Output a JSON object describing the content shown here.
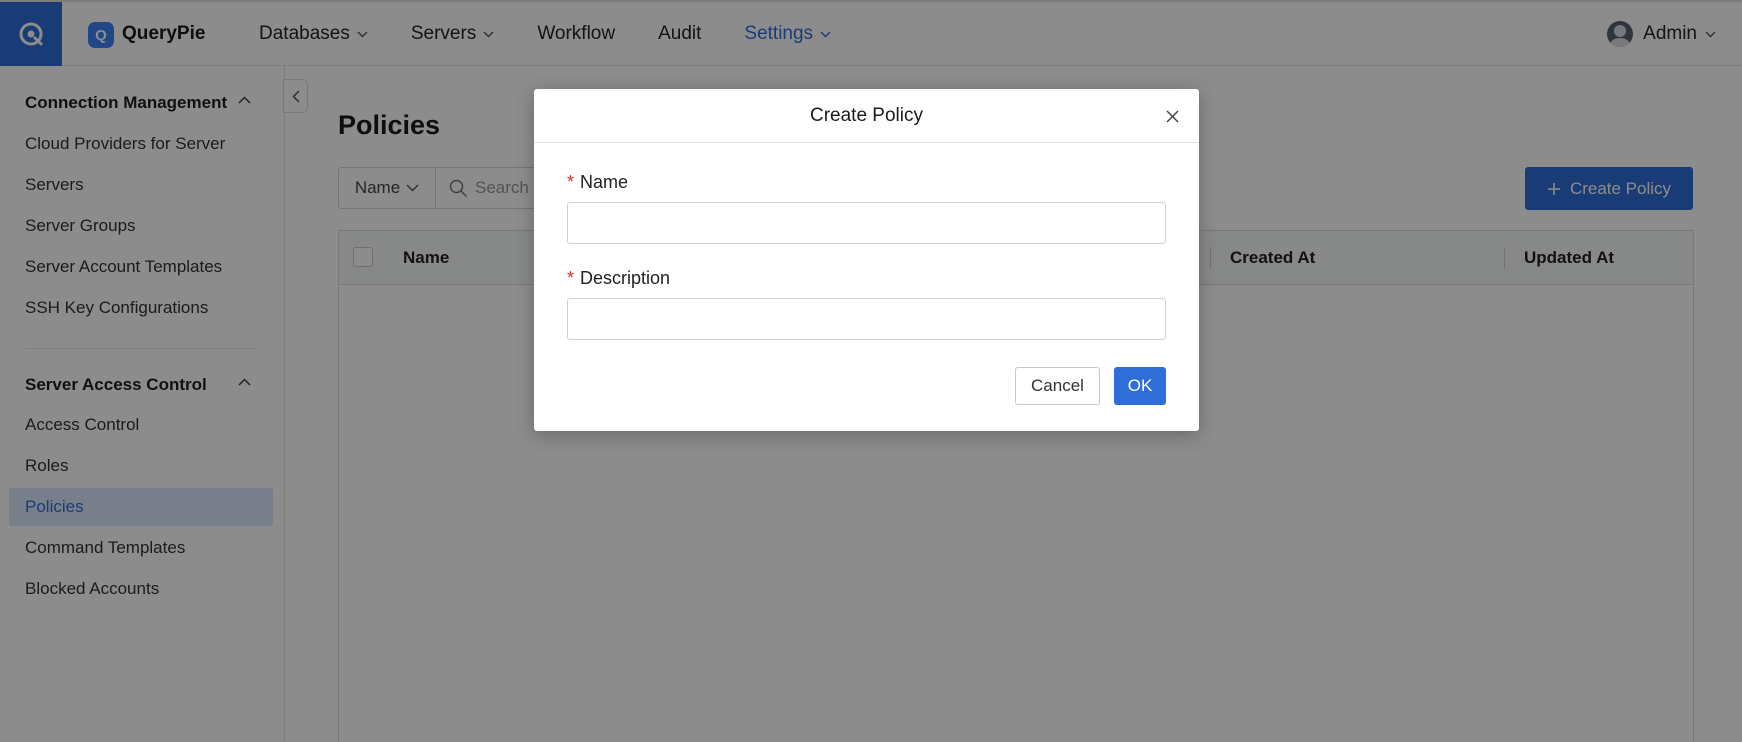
{
  "app": {
    "name": "QueryPie",
    "logo_letter": "Q"
  },
  "nav": {
    "items": [
      {
        "label": "Databases",
        "has_dropdown": true,
        "active": false
      },
      {
        "label": "Servers",
        "has_dropdown": true,
        "active": false
      },
      {
        "label": "Workflow",
        "has_dropdown": false,
        "active": false
      },
      {
        "label": "Audit",
        "has_dropdown": false,
        "active": false
      },
      {
        "label": "Settings",
        "has_dropdown": true,
        "active": true
      }
    ],
    "user": "Admin"
  },
  "sidebar": {
    "sections": [
      {
        "title": "Connection Management",
        "items": [
          "Cloud Providers for Server",
          "Servers",
          "Server Groups",
          "Server Account Templates",
          "SSH Key Configurations"
        ]
      },
      {
        "title": "Server Access Control",
        "items": [
          "Access Control",
          "Roles",
          "Policies",
          "Command Templates",
          "Blocked Accounts"
        ]
      }
    ],
    "active_item": "Policies"
  },
  "main": {
    "title": "Policies",
    "filter": {
      "selected": "Name",
      "search_placeholder": "Search"
    },
    "create_button": "Create Policy",
    "table": {
      "columns": [
        "Name",
        "Created At",
        "Updated At"
      ]
    }
  },
  "modal": {
    "title": "Create Policy",
    "fields": [
      {
        "label": "Name",
        "required": true,
        "value": ""
      },
      {
        "label": "Description",
        "required": true,
        "value": ""
      }
    ],
    "cancel_label": "Cancel",
    "ok_label": "OK"
  },
  "colors": {
    "accent": "#2f6ed9",
    "active_bg": "#dce8fb",
    "required": "#d93025"
  }
}
